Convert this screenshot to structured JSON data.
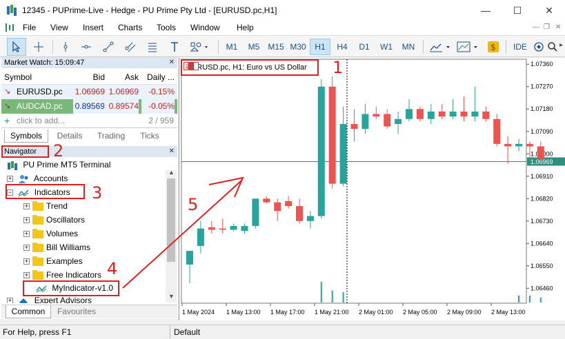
{
  "window": {
    "title": "12345 - PUPrime-Live - Hedge - PU Prime Pty Ltd - [EURUSD.pc,H1]"
  },
  "menu": [
    "File",
    "View",
    "Insert",
    "Charts",
    "Tools",
    "Window",
    "Help"
  ],
  "toolbar": {
    "timeframes": [
      "M1",
      "M5",
      "M15",
      "M30",
      "H1",
      "H4",
      "D1",
      "W1",
      "MN"
    ],
    "active_timeframe": "H1",
    "ide_label": "IDE"
  },
  "market_watch": {
    "title": "Market Watch: 15:09:47",
    "columns": [
      "Symbol",
      "Bid",
      "Ask",
      "Daily ..."
    ],
    "rows": [
      {
        "symbol": "EURUSD.pc",
        "bid": "1.06969",
        "ask": "1.06969",
        "daily": "-0.15%"
      },
      {
        "symbol": "AUDCAD.pc",
        "bid": "0.89569",
        "ask": "0.89574",
        "daily": "-0.05%"
      }
    ],
    "add_placeholder": "click to add...",
    "count": "2 / 959",
    "tabs": [
      "Symbols",
      "Details",
      "Trading",
      "Ticks"
    ]
  },
  "navigator": {
    "title": "Navigator",
    "root": "PU Prime MT5 Terminal",
    "accounts": "Accounts",
    "indicators": "Indicators",
    "folders": [
      "Trend",
      "Oscillators",
      "Volumes",
      "Bill Williams",
      "Examples",
      "Free Indicators"
    ],
    "custom_indicator": "MyIndicator-v1.0",
    "expert_advisors": "Expert Advisors",
    "tabs": [
      "Common",
      "Favourites"
    ]
  },
  "chart": {
    "symbol_label": "EURUSD.pc, H1:  Euro vs US Dollar",
    "current_price": "1.06969"
  },
  "annotations": [
    "1",
    "2",
    "3",
    "4",
    "5"
  ],
  "status": {
    "help": "For Help, press F1",
    "profile": "Default"
  },
  "chart_data": {
    "type": "candlestick",
    "y_ticks": [
      "1.07360",
      "1.07270",
      "1.07180",
      "1.07090",
      "1.07000",
      "1.06910",
      "1.06820",
      "1.06730",
      "1.06640",
      "1.06550",
      "1.06460"
    ],
    "x_ticks": [
      "1 May 2024",
      "1 May 13:00",
      "1 May 17:00",
      "1 May 21:00",
      "2 May 01:00",
      "2 May 05:00",
      "2 May 09:00",
      "2 May 13:00"
    ],
    "ylim": [
      1.064,
      1.0738
    ],
    "current_price": 1.06969,
    "candles": [
      {
        "o": 1.06555,
        "h": 1.0661,
        "l": 1.0648,
        "c": 1.0661
      },
      {
        "o": 1.0663,
        "h": 1.0673,
        "l": 1.066,
        "c": 1.067
      },
      {
        "o": 1.06705,
        "h": 1.0673,
        "l": 1.0668,
        "c": 1.06695
      },
      {
        "o": 1.067,
        "h": 1.0674,
        "l": 1.0668,
        "c": 1.06695
      },
      {
        "o": 1.06695,
        "h": 1.0672,
        "l": 1.0669,
        "c": 1.0671
      },
      {
        "o": 1.0669,
        "h": 1.0672,
        "l": 1.0668,
        "c": 1.0671
      },
      {
        "o": 1.0671,
        "h": 1.0682,
        "l": 1.067,
        "c": 1.0682
      },
      {
        "o": 1.0682,
        "h": 1.0683,
        "l": 1.068,
        "c": 1.06805
      },
      {
        "o": 1.06805,
        "h": 1.0682,
        "l": 1.0673,
        "c": 1.0677
      },
      {
        "o": 1.0681,
        "h": 1.0683,
        "l": 1.0678,
        "c": 1.0679
      },
      {
        "o": 1.0679,
        "h": 1.0682,
        "l": 1.0672,
        "c": 1.0673
      },
      {
        "o": 1.0673,
        "h": 1.0677,
        "l": 1.067,
        "c": 1.0675
      },
      {
        "o": 1.0675,
        "h": 1.073,
        "l": 1.0674,
        "c": 1.0727
      },
      {
        "o": 1.0727,
        "h": 1.0731,
        "l": 1.0686,
        "c": 1.0688
      },
      {
        "o": 1.0688,
        "h": 1.0719,
        "l": 1.0687,
        "c": 1.0712
      },
      {
        "o": 1.0712,
        "h": 1.0718,
        "l": 1.0705,
        "c": 1.071
      },
      {
        "o": 1.071,
        "h": 1.072,
        "l": 1.0708,
        "c": 1.0716
      },
      {
        "o": 1.0716,
        "h": 1.0719,
        "l": 1.0714,
        "c": 1.0715
      },
      {
        "o": 1.0716,
        "h": 1.0718,
        "l": 1.071,
        "c": 1.0711
      },
      {
        "o": 1.0712,
        "h": 1.0717,
        "l": 1.0708,
        "c": 1.0714
      },
      {
        "o": 1.0714,
        "h": 1.0722,
        "l": 1.0713,
        "c": 1.0718
      },
      {
        "o": 1.0718,
        "h": 1.0719,
        "l": 1.0713,
        "c": 1.0714
      },
      {
        "o": 1.0714,
        "h": 1.072,
        "l": 1.0712,
        "c": 1.0717
      },
      {
        "o": 1.0717,
        "h": 1.072,
        "l": 1.0714,
        "c": 1.0715
      },
      {
        "o": 1.0715,
        "h": 1.0722,
        "l": 1.0714,
        "c": 1.0717
      },
      {
        "o": 1.0717,
        "h": 1.0723,
        "l": 1.0713,
        "c": 1.0715
      },
      {
        "o": 1.0715,
        "h": 1.0727,
        "l": 1.0713,
        "c": 1.0717
      },
      {
        "o": 1.0717,
        "h": 1.0719,
        "l": 1.0713,
        "c": 1.0714
      },
      {
        "o": 1.0714,
        "h": 1.0716,
        "l": 1.0703,
        "c": 1.0704
      },
      {
        "o": 1.0704,
        "h": 1.0707,
        "l": 1.0696,
        "c": 1.0703
      },
      {
        "o": 1.0703,
        "h": 1.0706,
        "l": 1.0701,
        "c": 1.0704
      },
      {
        "o": 1.0704,
        "h": 1.0705,
        "l": 1.0697,
        "c": 1.0703
      },
      {
        "o": 1.0703,
        "h": 1.0705,
        "l": 1.0696,
        "c": 1.0698
      }
    ]
  }
}
